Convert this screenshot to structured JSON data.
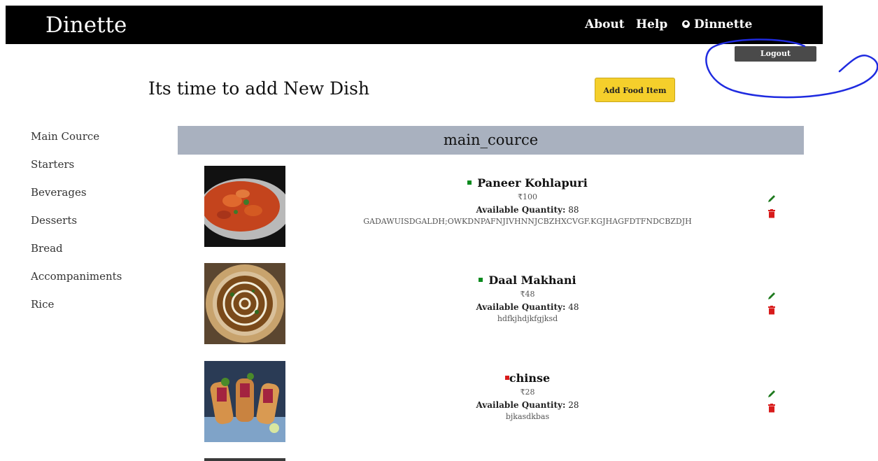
{
  "nav": {
    "brand": "Dinette",
    "about": "About",
    "help": "Help",
    "user": "Dinnette",
    "logout": "Logout"
  },
  "page": {
    "title": "Its time to add New Dish",
    "add_button": "Add Food Item"
  },
  "sidebar": {
    "items": [
      {
        "label": "Main Cource"
      },
      {
        "label": "Starters"
      },
      {
        "label": "Beverages"
      },
      {
        "label": "Desserts"
      },
      {
        "label": "Bread"
      },
      {
        "label": "Accompaniments"
      },
      {
        "label": "Rice"
      }
    ]
  },
  "section": {
    "title": "main_cource"
  },
  "dishes": [
    {
      "name": "Paneer Kohlapuri",
      "price": "₹100",
      "qty_label": "Available Quantity:",
      "qty": "88",
      "desc": "GADAWUISDGALDH;OWKDNPAFNJIVHNNJCBZHXCVGF.KGJHAGFDTFNDCBZDJH",
      "veg": true
    },
    {
      "name": "Daal Makhani",
      "price": "₹48",
      "qty_label": "Available Quantity:",
      "qty": "48",
      "desc": "hdfkjhdjkfgjksd",
      "veg": true
    },
    {
      "name": "chinse",
      "price": "₹28",
      "qty_label": "Available Quantity:",
      "qty": "28",
      "desc": "bjkasdkbas",
      "veg": false
    }
  ],
  "colors": {
    "veg": "#0a8a1e",
    "nonveg": "#d91a1a",
    "edit": "#1e7a1e",
    "delete": "#d81b1b",
    "annotation": "#1f2be0"
  },
  "icons": {
    "user": "user-circle-icon",
    "edit": "pencil-icon",
    "delete": "trash-icon"
  }
}
